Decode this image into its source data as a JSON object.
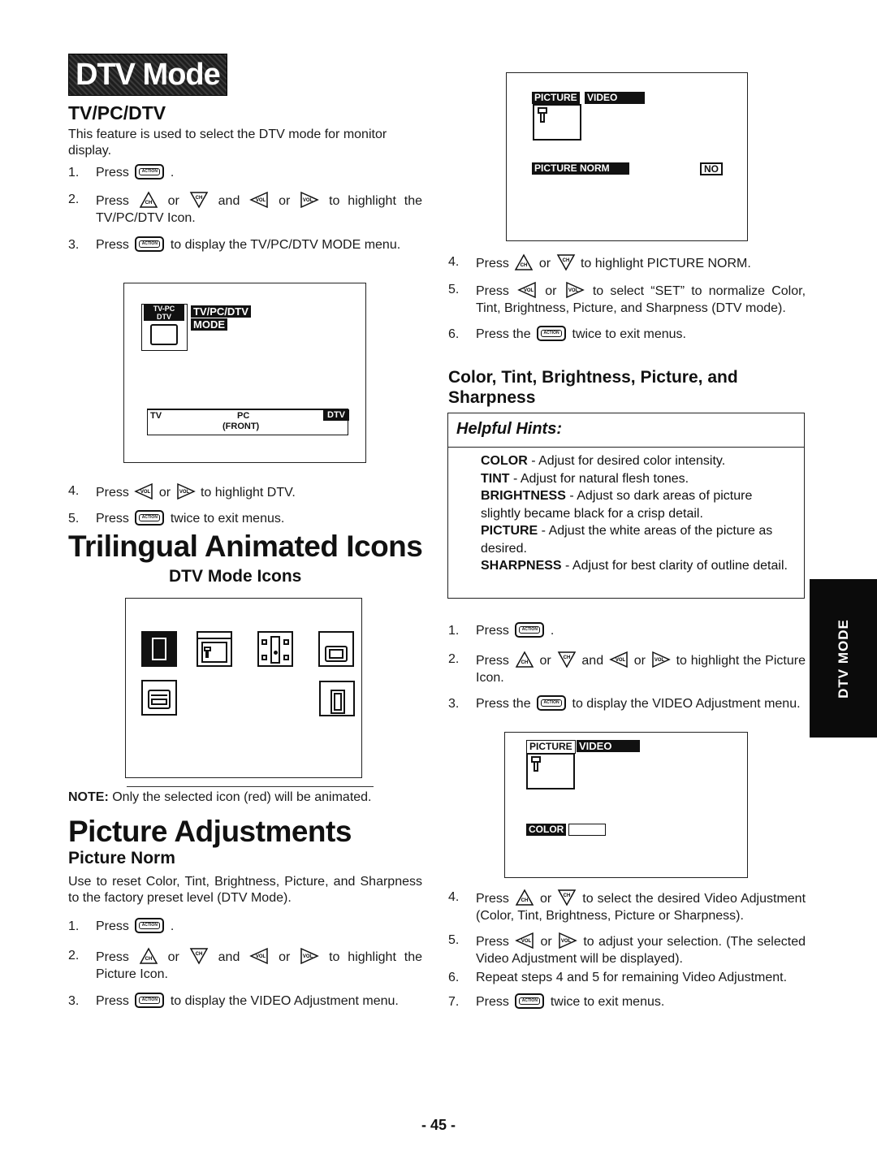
{
  "section_banner": "DTV Mode",
  "side_tab": "DTV MODE",
  "page_number": "- 45 -",
  "buttons": {
    "action": "ACTION",
    "ch_up": "CH",
    "ch_down": "CH",
    "vol_left": "VOL",
    "vol_right": "VOL"
  },
  "tvpcdtv": {
    "heading": "TV/PC/DTV",
    "intro": "This feature is used to select the DTV mode for monitor display.",
    "steps": [
      {
        "num": "1.",
        "pre": "Press",
        "post": "."
      },
      {
        "num": "2.",
        "pre": "Press",
        "or1": "or",
        "and": "and",
        "or2": "or",
        "post": "to highlight the TV/PC/DTV Icon."
      },
      {
        "num": "3.",
        "pre": "Press",
        "post": "to display the TV/PC/DTV MODE menu."
      },
      {
        "num": "4.",
        "pre": "Press",
        "or1": "or",
        "post": "to highlight DTV."
      },
      {
        "num": "5.",
        "pre": "Press",
        "post": "twice to exit menus."
      }
    ],
    "screen": {
      "icon_label_line1": "TV-PC",
      "icon_label_line2": "DTV",
      "menu_title_line1": "TV/PC/DTV",
      "menu_title_line2": "MODE",
      "options": [
        "TV",
        "PC",
        "(FRONT)",
        "DTV"
      ],
      "selected_option": "DTV"
    }
  },
  "trilingual": {
    "heading": "Trilingual Animated Icons",
    "subheading": "DTV Mode Icons",
    "icons": [
      "tv-pc-dtv-icon",
      "picture-icon",
      "audio-icon",
      "timer-icon",
      "setup-icon",
      "lock-icon"
    ],
    "selected_icon": "tv-pc-dtv-icon",
    "note_label": "NOTE:",
    "note_text": "Only the selected icon (red) will be animated."
  },
  "picture_adjustments": {
    "heading": "Picture Adjustments",
    "norm": {
      "heading": "Picture Norm",
      "intro": "Use to reset Color, Tint, Brightness, Picture, and Sharpness to the factory preset level (DTV Mode).",
      "steps": [
        {
          "num": "1.",
          "pre": "Press",
          "post": "."
        },
        {
          "num": "2.",
          "pre": "Press",
          "or1": "or",
          "and": "and",
          "or2": "or",
          "post": "to highlight the Picture Icon."
        },
        {
          "num": "3.",
          "pre": "Press",
          "post": "to display the VIDEO Adjustment menu."
        },
        {
          "num": "4.",
          "pre": "Press",
          "or1": "or",
          "post": "to highlight PICTURE NORM."
        },
        {
          "num": "5.",
          "pre": "Press",
          "or1": "or",
          "post": "to select “SET” to normalize Color, Tint, Brightness, Picture, and Sharpness (DTV mode)."
        },
        {
          "num": "6.",
          "pre": "Press the",
          "post": "twice to exit menus."
        }
      ],
      "screen": {
        "tab_picture": "PICTURE",
        "tab_video": "VIDEO",
        "item_label": "PICTURE NORM",
        "item_value": "NO"
      }
    },
    "ctbps": {
      "heading": "Color, Tint, Brightness, Picture, and Sharpness",
      "hints_title": "Helpful Hints:",
      "hints": [
        {
          "term": "COLOR",
          "desc": " - Adjust for desired color intensity."
        },
        {
          "term": "TINT",
          "desc": " - Adjust for natural flesh tones."
        },
        {
          "term": "BRIGHTNESS",
          "desc": " - Adjust so dark areas of picture slightly became black for a crisp detail."
        },
        {
          "term": "PICTURE",
          "desc": " - Adjust the white areas of the picture as desired."
        },
        {
          "term": "SHARPNESS",
          "desc": " - Adjust for best clarity of outline detail."
        }
      ],
      "steps": [
        {
          "num": "1.",
          "pre": "Press",
          "post": "."
        },
        {
          "num": "2.",
          "pre": "Press",
          "or1": "or",
          "and": "and",
          "or2": "or",
          "post": "to highlight the Picture Icon."
        },
        {
          "num": "3.",
          "pre": "Press the",
          "post": "to display the VIDEO Adjustment menu."
        },
        {
          "num": "4.",
          "pre": "Press",
          "or1": "or",
          "post": "to select the desired Video Adjustment (Color, Tint, Brightness, Picture or Sharpness)."
        },
        {
          "num": "5.",
          "pre": "Press",
          "or1": "or",
          "post": "to adjust your selection. (The selected Video Adjustment will be displayed)."
        },
        {
          "num": "6.",
          "pre": "Repeat steps 4 and 5 for remaining Video Adjustment.",
          "post": ""
        },
        {
          "num": "7.",
          "pre": "Press",
          "post": "twice to exit menus."
        }
      ],
      "screen": {
        "tab_picture": "PICTURE",
        "tab_video": "VIDEO",
        "item_label": "COLOR"
      }
    }
  }
}
